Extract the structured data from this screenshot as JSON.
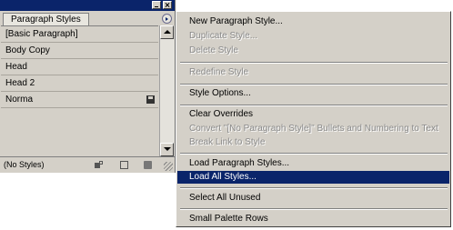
{
  "panel": {
    "tab_label": "Paragraph Styles",
    "styles": [
      {
        "label": "[Basic Paragraph]"
      },
      {
        "label": "Body Copy"
      },
      {
        "label": "Head"
      },
      {
        "label": "Head 2"
      },
      {
        "label": "Norma",
        "icon": "disk-icon"
      }
    ],
    "footer_label": "(No Styles)"
  },
  "menu": {
    "items": [
      {
        "label": "New Paragraph Style...",
        "enabled": true
      },
      {
        "label": "Duplicate Style...",
        "enabled": false
      },
      {
        "label": "Delete Style",
        "enabled": false
      },
      {
        "label": "Redefine Style",
        "enabled": false
      },
      {
        "label": "Style Options...",
        "enabled": true
      },
      {
        "label": "Clear Overrides",
        "enabled": true
      },
      {
        "label": "Convert \"[No Paragraph Style]\" Bullets and Numbering to Text",
        "enabled": false
      },
      {
        "label": "Break Link to Style",
        "enabled": false
      },
      {
        "label": "Load Paragraph Styles...",
        "enabled": true
      },
      {
        "label": "Load All Styles...",
        "enabled": true,
        "selected": true
      },
      {
        "label": "Select All Unused",
        "enabled": true
      },
      {
        "label": "Small Palette Rows",
        "enabled": true
      }
    ]
  },
  "colors": {
    "titlebar": "#0a246a",
    "selection": "#0a246a",
    "panel_bg": "#d4d0c8"
  }
}
